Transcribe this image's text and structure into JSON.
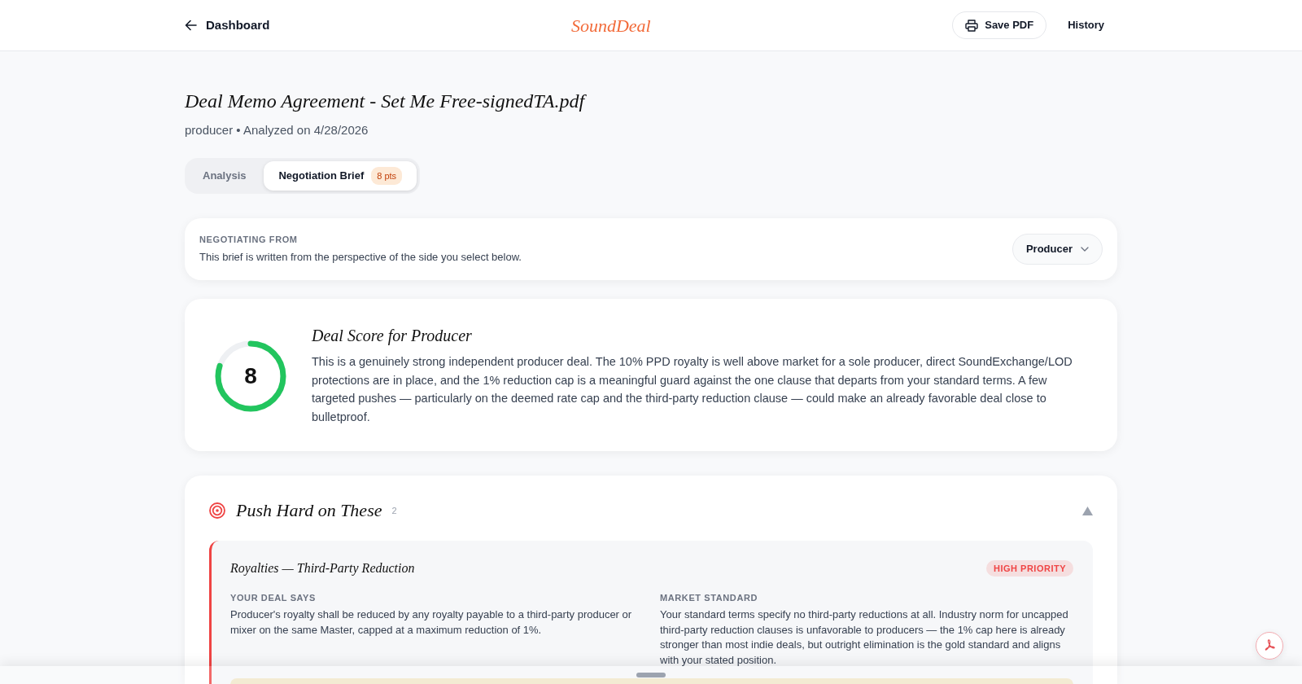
{
  "header": {
    "back_link": "Dashboard",
    "logo": "SoundDeal",
    "actions": [
      {
        "label": "Save PDF",
        "kind": "outlined"
      },
      {
        "label": "History",
        "kind": "plain"
      }
    ]
  },
  "document": {
    "title": "Deal Memo Agreement - Set Me Free-signedTA.pdf",
    "subtitle": "producer • Analyzed on 4/28/2026"
  },
  "tabs": [
    {
      "label": "Analysis",
      "selected": false
    },
    {
      "label": "Negotiation Brief",
      "selected": true,
      "badge": "8 pts"
    }
  ],
  "perspective": {
    "label": "NEGOTIATING FROM",
    "description": "This brief is written from the perspective of the side you select below.",
    "value": "Producer"
  },
  "score": {
    "value": "8",
    "level": 0.8,
    "title": "Deal Score for Producer",
    "summary": "This is a genuinely strong independent producer deal. The 10% PPD royalty is well above market for a sole producer, direct SoundExchange/LOD protections are in place, and the 1% reduction cap is a meaningful guard against the one clause that departs from your standard terms. A few targeted pushes — particularly on the deemed rate cap and the third-party reduction clause — could make an already favorable deal close to bulletproof."
  },
  "sections": [
    {
      "title": "Push Hard on These",
      "count": "2",
      "expanded": true,
      "items": [
        {
          "title": "Royalties — Third-Party Reduction",
          "color": "#ef4444",
          "badge": "HIGH PRIORITY",
          "columns": [
            {
              "label": "YOUR DEAL SAYS",
              "text": "Producer's royalty shall be reduced by any royalty payable to a third-party producer or mixer on the same Master, capped at a maximum reduction of 1%."
            },
            {
              "label": "MARKET STANDARD",
              "text": "Your standard terms specify no third-party reductions at all. Industry norm for uncapped third-party reduction clauses is unfavorable to producers — the 1% cap here is already stronger than most indie deals, but outright elimination is the gold standard and aligns with your stated position."
            }
          ]
        }
      ]
    }
  ]
}
